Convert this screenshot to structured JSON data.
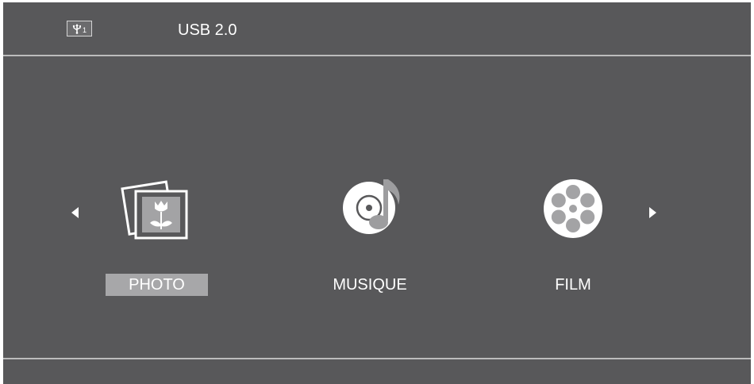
{
  "header": {
    "usb_port_number": "1",
    "usb_icon": "usb-icon",
    "device_name": "USB 2.0"
  },
  "navigation": {
    "prev_icon": "triangle-left-icon",
    "next_icon": "triangle-right-icon"
  },
  "media_items": [
    {
      "label": "PHOTO",
      "icon": "photo-icon",
      "selected": true
    },
    {
      "label": "MUSIQUE",
      "icon": "music-disc-icon",
      "selected": false
    },
    {
      "label": "FILM",
      "icon": "film-reel-icon",
      "selected": false
    }
  ],
  "colors": {
    "background": "#58585a",
    "divider": "#bcbcbc",
    "selection": "#a7a7a9",
    "text": "#ffffff"
  }
}
